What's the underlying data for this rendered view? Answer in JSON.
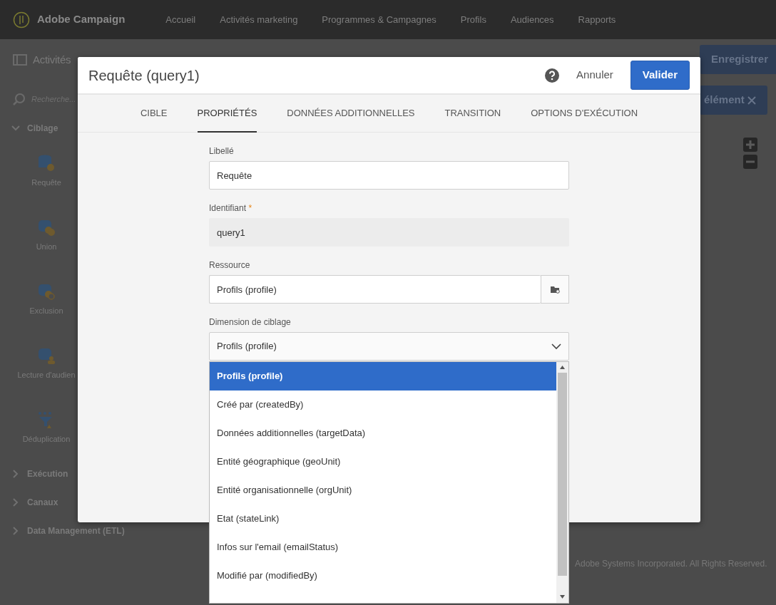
{
  "header": {
    "app_name": "Adobe Campaign",
    "nav": [
      "Accueil",
      "Activités marketing",
      "Programmes & Campagnes",
      "Profils",
      "Audiences",
      "Rapports"
    ]
  },
  "toolbar": {
    "title": "Activités",
    "save_button": "Enregistrer",
    "element_button": "élément"
  },
  "search": {
    "placeholder": "Recherche..."
  },
  "sidebar": {
    "groups": [
      {
        "label": "Ciblage",
        "expanded": true,
        "items": [
          {
            "label": "Requête",
            "kind": "query"
          },
          {
            "label": "Union",
            "kind": "union"
          },
          {
            "label": "Exclusion",
            "kind": "exclusion"
          },
          {
            "label": "Lecture d'audien",
            "kind": "audience"
          },
          {
            "label": "Déduplication",
            "kind": "dedup"
          }
        ]
      },
      {
        "label": "Exécution",
        "expanded": false
      },
      {
        "label": "Canaux",
        "expanded": false
      },
      {
        "label": "Data Management (ETL)",
        "expanded": false
      }
    ]
  },
  "footer": "Adobe Systems Incorporated. All Rights Reserved.",
  "dialog": {
    "title": "Requête (query1)",
    "cancel": "Annuler",
    "validate": "Valider",
    "required_mark": "*",
    "tabs": [
      {
        "label": "CIBLE",
        "selected": false
      },
      {
        "label": "PROPRIÉTÉS",
        "selected": true
      },
      {
        "label": "DONNÉES ADDITIONNELLES",
        "selected": false
      },
      {
        "label": "TRANSITION",
        "selected": false
      },
      {
        "label": "OPTIONS D'EXÉCUTION",
        "selected": false
      }
    ],
    "fields": [
      {
        "label": "Libellé",
        "required": false,
        "kind": "text",
        "value": "Requête"
      },
      {
        "label": "Identifiant",
        "required": true,
        "kind": "readonly",
        "value": "query1"
      },
      {
        "label": "Ressource",
        "required": false,
        "kind": "picker",
        "value": "Profils (profile)"
      },
      {
        "label": "Dimension de ciblage",
        "required": false,
        "kind": "select",
        "value": "Profils (profile)"
      }
    ],
    "dropdown": {
      "options": [
        {
          "label": "Profils (profile)",
          "selected": true
        },
        {
          "label": "Créé par (createdBy)",
          "selected": false
        },
        {
          "label": "Données additionnelles (targetData)",
          "selected": false
        },
        {
          "label": "Entité géographique (geoUnit)",
          "selected": false
        },
        {
          "label": "Entité organisationnelle (orgUnit)",
          "selected": false
        },
        {
          "label": "Etat (stateLink)",
          "selected": false
        },
        {
          "label": "Infos sur l'email (emailStatus)",
          "selected": false
        },
        {
          "label": "Modifié par (modifiedBy)",
          "selected": false
        }
      ]
    }
  }
}
